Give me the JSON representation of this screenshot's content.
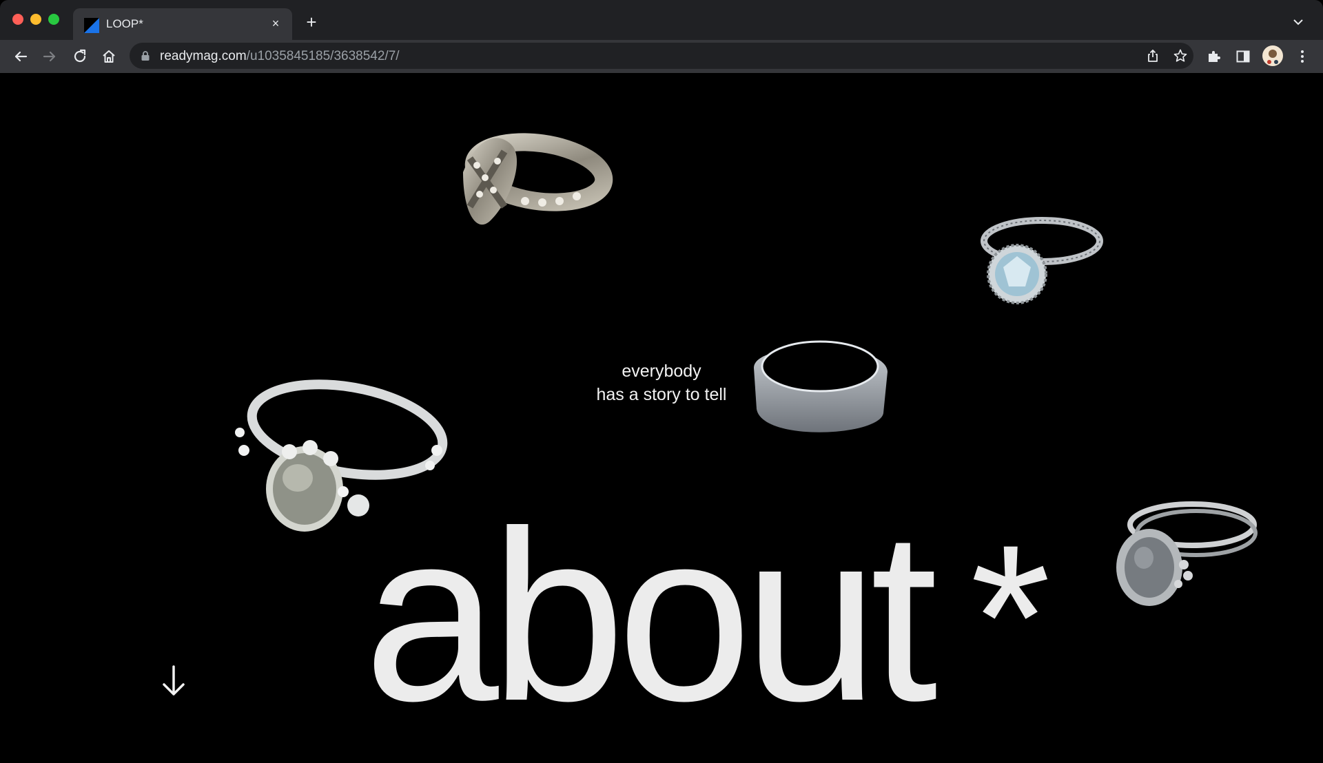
{
  "browser": {
    "tab_title": "LOOP*",
    "tab_close": "×",
    "new_tab": "+",
    "url_host": "readymag.com",
    "url_path": "/u1035845185/3638542/7/"
  },
  "page": {
    "tagline_line1": "everybody",
    "tagline_line2": "has a story to tell",
    "headline": "about",
    "headline_mark": "*",
    "scroll_icon": "arrow-down-icon"
  },
  "colors": {
    "background": "#000000",
    "text": "#ececec",
    "chrome_dark": "#202124",
    "chrome_light": "#35363a",
    "favicon_blue": "#1a73e8"
  }
}
